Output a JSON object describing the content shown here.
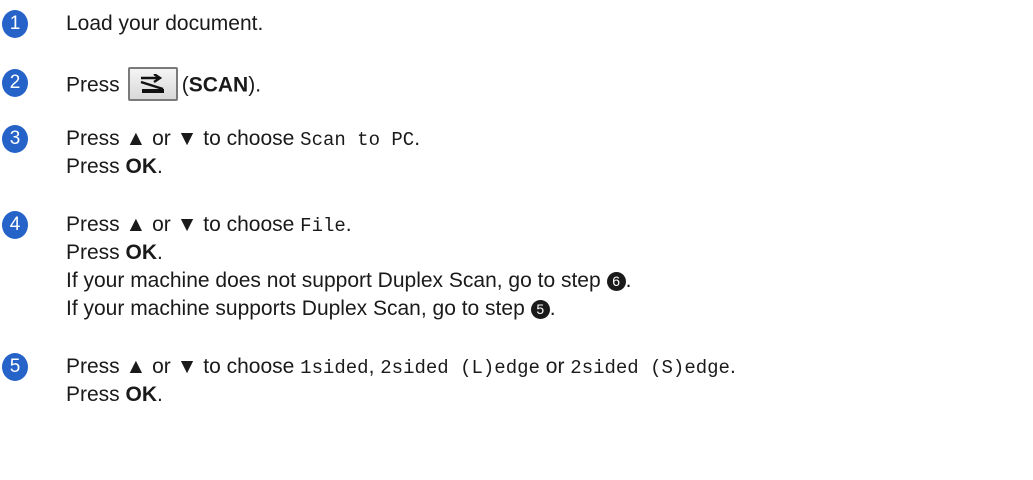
{
  "steps": [
    {
      "num": "1",
      "text": "Load your document."
    },
    {
      "num": "2",
      "press": "Press",
      "button_label": "SCAN",
      "open_paren": "(",
      "close_paren": ")."
    },
    {
      "num": "3",
      "press": "Press ▲ or ▼ to choose",
      "option": "Scan to PC",
      "after": ".",
      "line2_a": "Press",
      "line2_b": "OK",
      "line2_c": "."
    },
    {
      "num": "4",
      "press": "Press ▲ or ▼ to choose",
      "option": "File",
      "after": ".",
      "line2_a": "Press",
      "line2_b": "OK",
      "line2_c": ".",
      "line3": "If your machine does not support Duplex Scan, go to step",
      "line3_ref": "6",
      "line3_end": ".",
      "line4": "If your machine supports Duplex Scan, go to step",
      "line4_ref": "5",
      "line4_end": "."
    },
    {
      "num": "5",
      "press": "Press ▲ or ▼ to choose",
      "opt1": "1sided",
      "sep1": ",",
      "opt2": "2sided (L)edge",
      "or": "or",
      "opt3": "2sided (S)edge",
      "after": ".",
      "line2_a": "Press",
      "line2_b": "OK",
      "line2_c": "."
    }
  ],
  "colors": {
    "step_badge": "#2563c9"
  },
  "icons": {
    "scan_button": "scan-arrow-icon"
  }
}
